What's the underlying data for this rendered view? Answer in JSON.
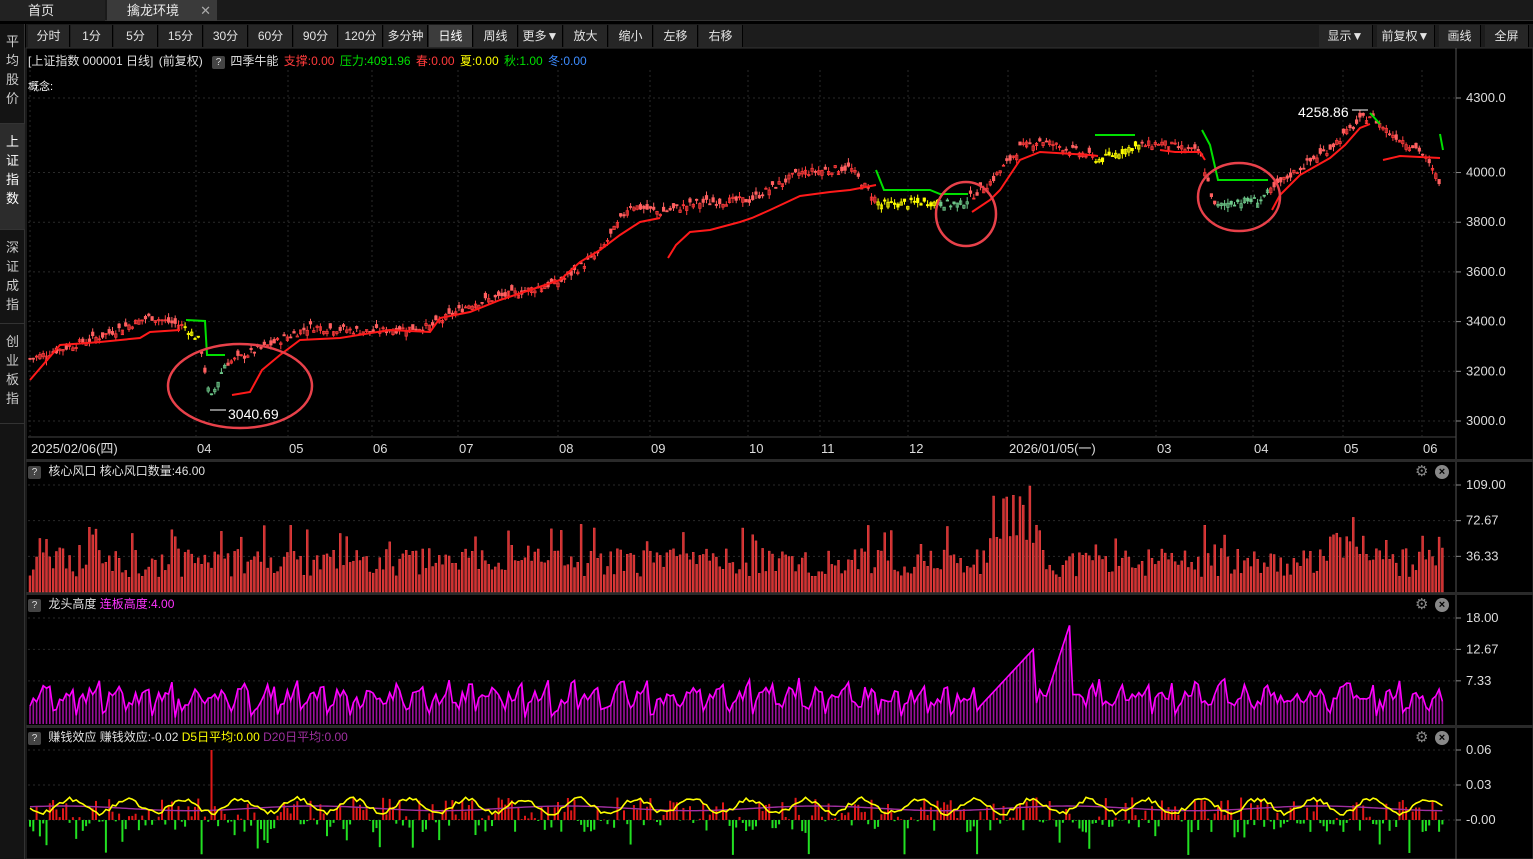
{
  "tabs": {
    "home": "首页",
    "active": "擒龙环境",
    "close": "✕"
  },
  "toolbar": {
    "periods": [
      "分时",
      "1分",
      "5分",
      "15分",
      "30分",
      "60分",
      "90分",
      "120分",
      "多分钟",
      "日线",
      "周线",
      "更多▼",
      "放大",
      "缩小",
      "左移",
      "右移"
    ],
    "active_period": "日线",
    "right": [
      "显示▼",
      "前复权▼",
      "画线",
      "全屏"
    ]
  },
  "left_tabs": [
    "平均股价",
    "上证指数",
    "深证成指",
    "创业板指"
  ],
  "left_tabs_active": "上证指数",
  "main_chart": {
    "header": "[上证指数 000001 日线]",
    "adjust": "(前复权)",
    "indicator": "四季牛能",
    "support": "支撑:0.00",
    "pressure": "压力:4091.96",
    "spring": "春:0.00",
    "summer": "夏:0.00",
    "autumn": "秋:1.00",
    "winter": "冬:0.00",
    "concept": "概念:",
    "y_ticks": [
      "4300.0",
      "4000.0",
      "3800.0",
      "3600.0",
      "3400.0",
      "3200.0",
      "3000.0"
    ],
    "x_labels": [
      "2025/02/06(四)",
      "04",
      "05",
      "06",
      "07",
      "08",
      "09",
      "10",
      "11",
      "12",
      "2026/01/05(一)",
      "03",
      "04",
      "05",
      "06"
    ],
    "low_label": "3040.69",
    "high_label": "4258.86"
  },
  "panel1": {
    "title": "核心风口",
    "value": "核心风口数量:46.00",
    "y_ticks": [
      "109.00",
      "72.67",
      "36.33"
    ]
  },
  "panel2": {
    "title": "龙头高度",
    "value": "连板高度:4.00",
    "y_ticks": [
      "18.00",
      "12.67",
      "7.33"
    ]
  },
  "panel3": {
    "title": "赚钱效应",
    "value": "赚钱效应:-0.02",
    "d5": "D5日平均:0.00",
    "d20": "D20日平均:0.00",
    "y_ticks": [
      "0.06",
      "0.03",
      "-0.00"
    ]
  },
  "colors": {
    "up": "#ff3b3b",
    "down": "#54ffff",
    "green": "#00e000",
    "yellow": "#ffff00",
    "magenta": "#ff00ff",
    "red_line": "#ff1a1a",
    "circle": "#e8414a",
    "grid": "#2a2a2a"
  },
  "chart_data": {
    "type": "line",
    "series": [
      {
        "x": [
          "2025/02/06",
          "04",
          "05",
          "06",
          "07",
          "08",
          "09",
          "10",
          "11",
          "12",
          "2026/01/05",
          "03",
          "04",
          "05",
          "06"
        ],
        "values": [
          3250,
          3240,
          3260,
          3360,
          3420,
          3560,
          3820,
          3880,
          3990,
          3900,
          3960,
          4120,
          3880,
          4150,
          4050
        ]
      }
    ],
    "ylim": [
      3000,
      4300
    ]
  }
}
